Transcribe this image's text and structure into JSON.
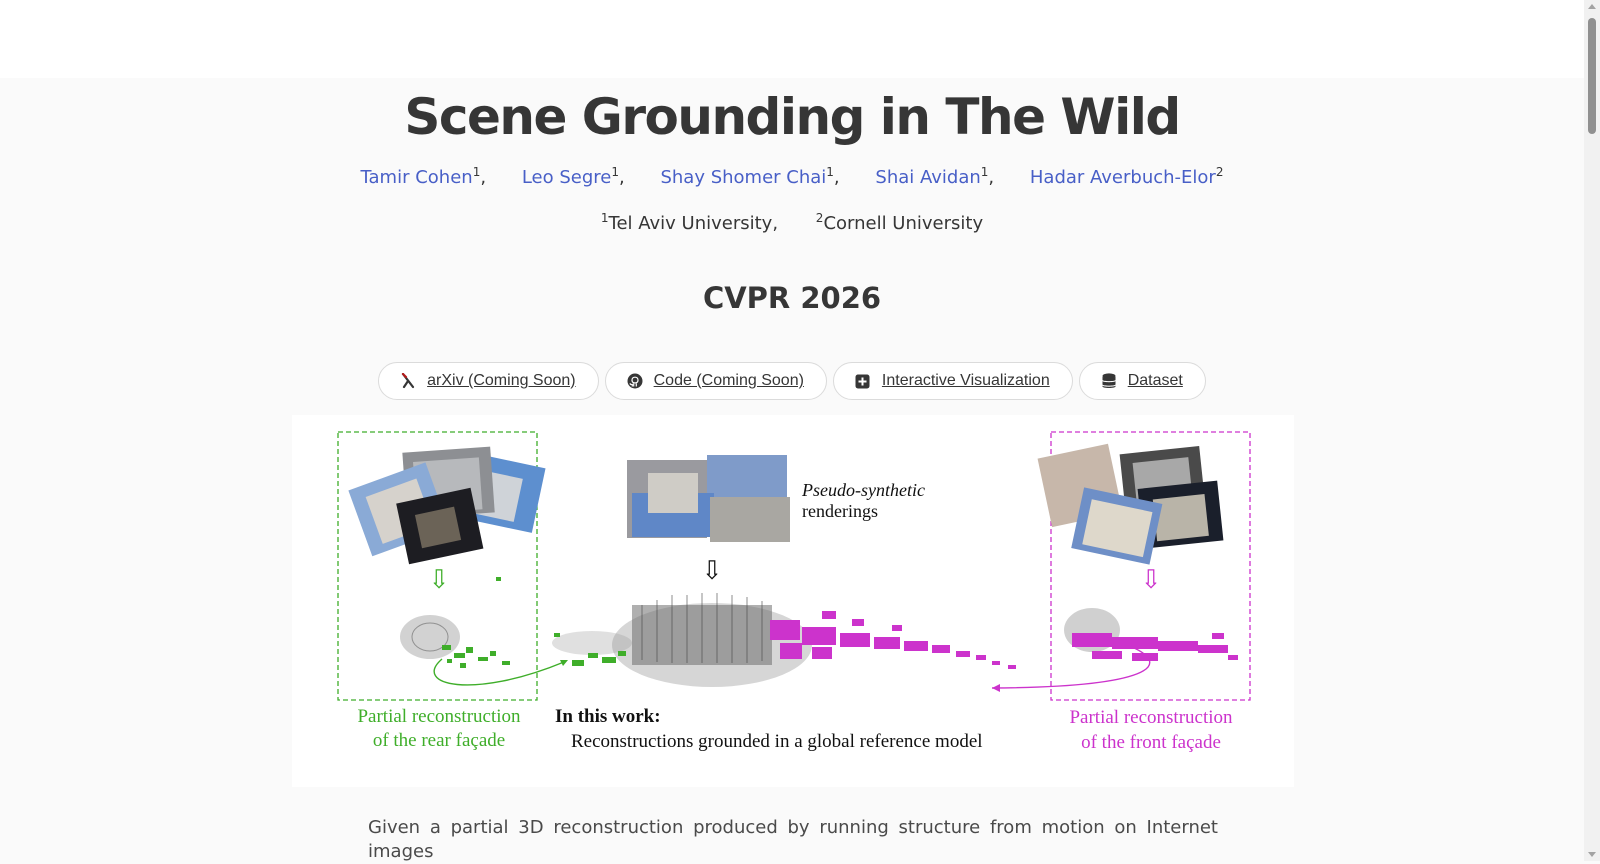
{
  "page": {
    "title": "Scene Grounding in The Wild",
    "venue": "CVPR 2026"
  },
  "authors": [
    {
      "name": "Tamir Cohen",
      "sup": "1",
      "sep": ","
    },
    {
      "name": "Leo Segre",
      "sup": "1",
      "sep": ","
    },
    {
      "name": "Shay Shomer Chai",
      "sup": "1",
      "sep": ","
    },
    {
      "name": "Shai Avidan",
      "sup": "1",
      "sep": ","
    },
    {
      "name": "Hadar Averbuch-Elor",
      "sup": "2",
      "sep": ""
    }
  ],
  "affiliations": [
    {
      "sup": "1",
      "name": "Tel Aviv University,"
    },
    {
      "sup": "2",
      "name": "Cornell University"
    }
  ],
  "buttons": {
    "arxiv": {
      "label": "arXiv (Coming Soon)",
      "icon": "arxiv-icon"
    },
    "code": {
      "label": "Code (Coming Soon)",
      "icon": "github-icon"
    },
    "viz": {
      "label": "Interactive Visualization",
      "icon": "plus-square-icon"
    },
    "dataset": {
      "label": "Dataset",
      "icon": "database-icon"
    }
  },
  "teaser": {
    "pseudo_line1": "Pseudo-synthetic",
    "pseudo_line2": "renderings",
    "left_caption_line1": "Partial reconstruction",
    "left_caption_line2": "of the rear façade",
    "center_heading": "In this work:",
    "center_text": "Reconstructions grounded in a global reference model",
    "right_caption_line1": "Partial reconstruction",
    "right_caption_line2": "of the front façade",
    "colors": {
      "green": "#3fae2a",
      "magenta": "#cc33cc",
      "cloud": "#777777"
    }
  },
  "abstract": {
    "first_line": "Given a partial 3D reconstruction produced by running structure from motion on Internet images"
  }
}
